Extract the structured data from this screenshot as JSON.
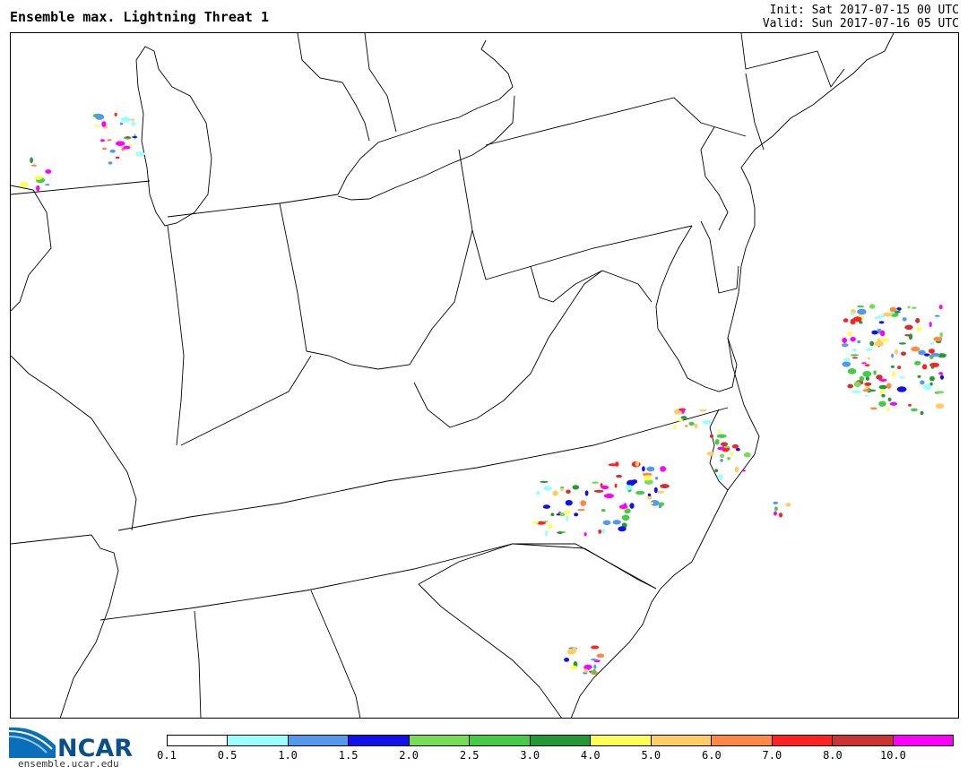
{
  "header": {
    "title": "Ensemble max. Lightning Threat 1",
    "init": "Init: Sat 2017-07-15 00 UTC",
    "valid": "Valid: Sun 2017-07-16 05 UTC"
  },
  "logo": {
    "text": "NCAR",
    "url": "ensemble.ucar.edu"
  },
  "colorbar": {
    "colors": [
      "#ffffff",
      "#99ffff",
      "#5599ee",
      "#1111ee",
      "#77dd55",
      "#44cc44",
      "#229933",
      "#ffff55",
      "#ffcc66",
      "#ff8844",
      "#ff2222",
      "#cc3333",
      "#ff00ff"
    ],
    "labels": [
      "0.1",
      "0.5",
      "1.0",
      "1.5",
      "2.0",
      "2.5",
      "3.0",
      "4.0",
      "5.0",
      "6.0",
      "7.0",
      "8.0",
      "10.0"
    ]
  }
}
